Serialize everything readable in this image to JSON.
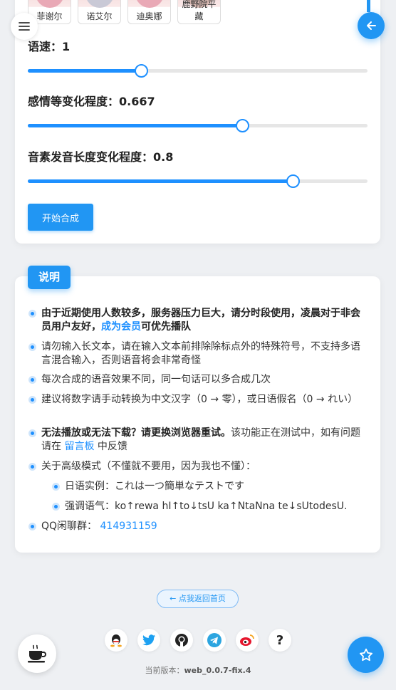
{
  "characters": [
    {
      "name": "菲谢尔"
    },
    {
      "name": "诺艾尔"
    },
    {
      "name": "迪奥娜"
    },
    {
      "name": "鹿野院平藏"
    }
  ],
  "sliders": [
    {
      "label": "语速：1",
      "value": 1,
      "fraction": 0.333
    },
    {
      "label": "感情等变化程度：0.667",
      "value": 0.667,
      "fraction": 0.63
    },
    {
      "label": "音素发音长度变化程度：0.8",
      "value": 0.8,
      "fraction": 0.78
    }
  ],
  "start_button": "开始合成",
  "info": {
    "badge": "说明",
    "items": [
      {
        "bold": "由于近期使用人数较多，服务器压力巨大，请分时段使用，凌晨对于非会员用户友好，",
        "link": "成为会员",
        "bold_after": "可优先播队"
      },
      {
        "text": "请勿输入长文本，请在输入文本前排除除标点外的特殊符号，不支持多语言混合输入，否则语音将会非常奇怪"
      },
      {
        "text": "每次合成的语音效果不同，同一句话可以多合成几次"
      },
      {
        "text": "建议将数字请手动转换为中文汉字（0 → 零），或日语假名（0 → れい）"
      },
      {
        "bold": "无法播放或无法下载？请更换浏览器重试。",
        "text": "该功能正在测试中，如有问题请在 ",
        "link": "留言板",
        "text_after": " 中反馈"
      },
      {
        "text": "关于高级模式（不懂就不要用，因为我也不懂）："
      },
      {
        "sub": true,
        "text": "日语实例：これは一つ簡単なテストです"
      },
      {
        "sub": true,
        "text": "强调语气：ko↑rewa hI↑to↓tsU ka↑NtaNna te↓sUtodesU."
      },
      {
        "text": "QQ闲聊群： ",
        "link": "414931159"
      }
    ]
  },
  "footer": {
    "home_button": "← 点我返回首页",
    "version_label": "当前版本：",
    "version_value": "web_0.0.7-fix.4",
    "socials": [
      "qq-icon",
      "twitter-icon",
      "github-icon",
      "telegram-icon",
      "weibo-icon",
      "help-icon"
    ]
  },
  "colors": {
    "accent": "#2196f3"
  }
}
